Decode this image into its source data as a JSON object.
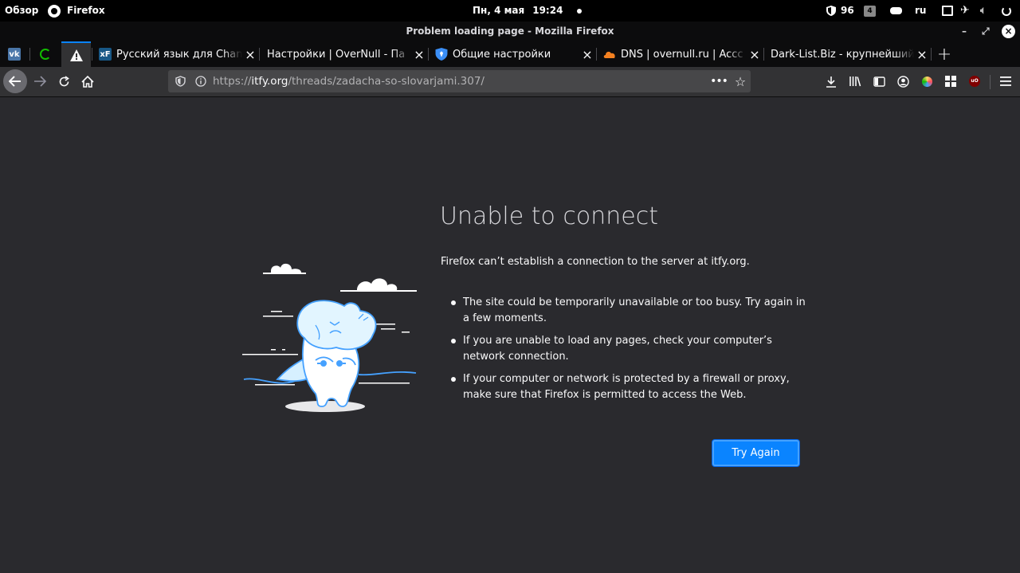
{
  "system_bar": {
    "activities": "Обзор",
    "app_name": "Firefox",
    "date": "Пн, 4 мая",
    "time": "19:24",
    "shield_count": "96",
    "workspace": "4",
    "keyboard_layout": "ru"
  },
  "window": {
    "title": "Problem loading page - Mozilla Firefox",
    "minimize": "–",
    "maximize": "⤢",
    "close": "×"
  },
  "tabs": [
    {
      "label": "",
      "icon": "vk-icon",
      "pinned": true
    },
    {
      "label": "",
      "icon": "loading-icon",
      "pinned": true
    },
    {
      "label": "",
      "icon": "warning-icon",
      "pinned": true,
      "active": true
    },
    {
      "label": "Русский язык для Chan",
      "icon": "xenforo-icon"
    },
    {
      "label": "Настройки | OverNull - Па",
      "icon": ""
    },
    {
      "label": "Общие настройки",
      "icon": "shield-icon"
    },
    {
      "label": "DNS | overnull.ru | Accc",
      "icon": "cloudflare-icon"
    },
    {
      "label": "Dark-List.Biz - крупнейший",
      "icon": ""
    }
  ],
  "new_tab": "+",
  "url_bar": {
    "protocol": "https://",
    "host": "itfy.org",
    "path": "/threads/zadacha-so-slovarjami.307/"
  },
  "error_page": {
    "title": "Unable to connect",
    "description": "Firefox can’t establish a connection to the server at itfy.org.",
    "suggestions": [
      "The site could be temporarily unavailable or too busy. Try again in a few moments.",
      "If you are unable to load any pages, check your computer’s network connection.",
      "If your computer or network is protected by a firewall or proxy, make sure that Firefox is permitted to access the Web."
    ],
    "button": "Try Again"
  }
}
